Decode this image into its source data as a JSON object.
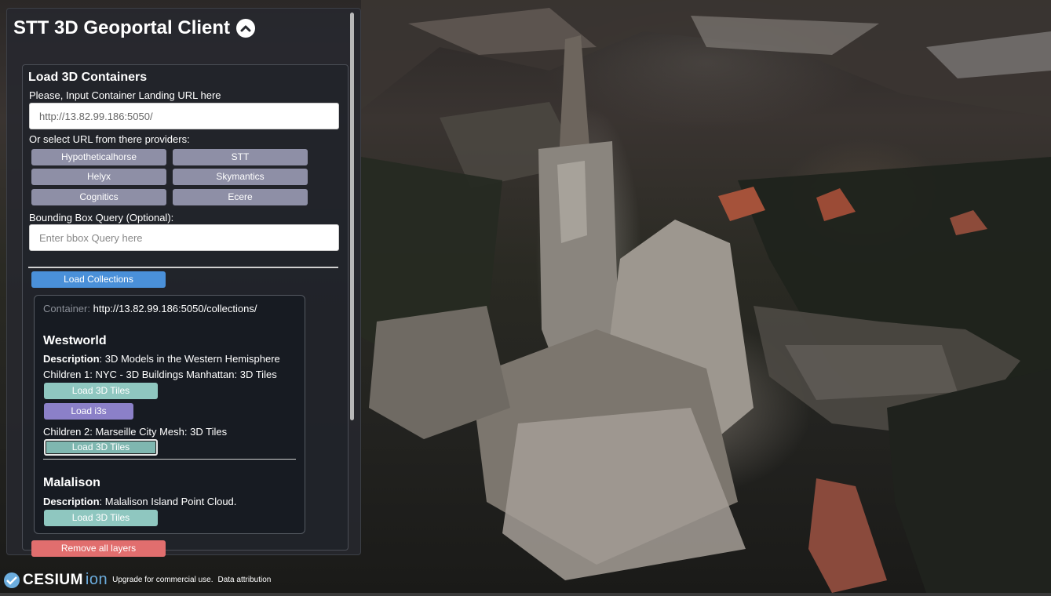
{
  "app": {
    "title": "STT 3D Geoportal Client"
  },
  "load_section": {
    "title": "Load 3D Containers",
    "url_label": "Please, Input Container Landing URL here",
    "url_value": "http://13.82.99.186:5050/",
    "providers_label": "Or select URL from there providers:",
    "providers": [
      "Hypotheticalhorse",
      "STT",
      "Helyx",
      "Skymantics",
      "Cognitics",
      "Ecere"
    ],
    "bbox_label": "Bounding Box Query (Optional):",
    "bbox_placeholder": "Enter bbox Query here",
    "load_collections_label": "Load Collections"
  },
  "collections": {
    "container_label": "Container:",
    "container_url": "http://13.82.99.186:5050/collections/",
    "items": [
      {
        "name": "Westworld",
        "description_label": "Description",
        "description": ": 3D Models in the Western Hemisphere",
        "children": [
          {
            "text": "Children 1: NYC - 3D Buildings Manhattan: 3D Tiles",
            "buttons": [
              "Load 3D Tiles",
              "Load i3s"
            ]
          },
          {
            "text": "Children 2: Marseille City Mesh: 3D Tiles",
            "buttons": [
              "Load 3D Tiles"
            ]
          }
        ]
      },
      {
        "name": "Malalison",
        "description_label": "Description",
        "description": ": Malalison Island Point Cloud.",
        "buttons": [
          "Load 3D Tiles"
        ]
      }
    ]
  },
  "remove_all_label": "Remove all layers",
  "footer": {
    "logo_text": "CESIUM",
    "logo_suffix": "ion",
    "upgrade_text": "Upgrade for commercial use.",
    "attribution_text": "Data attribution"
  },
  "icons": {
    "collapse": "chevron-up-circle-icon"
  },
  "colors": {
    "provider_button": "#8e8fa6",
    "load_collections": "#4a90d9",
    "load_3d_tiles": "#8fc7c0",
    "load_i3s": "#8b80c8",
    "remove_all": "#e16e6e"
  }
}
